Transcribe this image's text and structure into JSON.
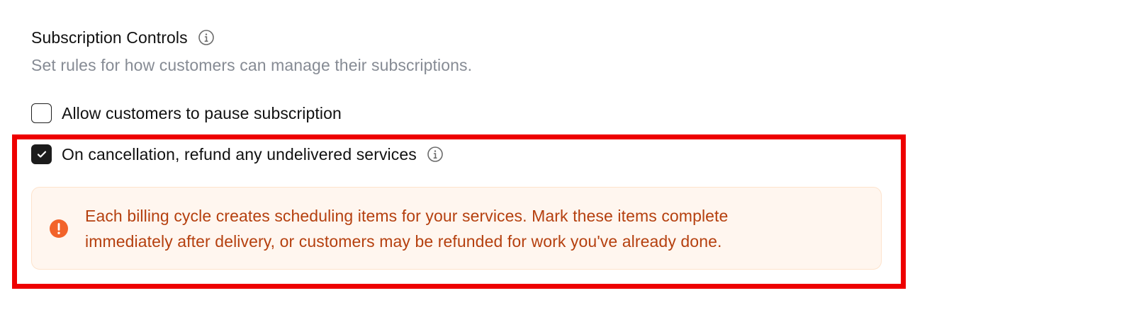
{
  "section": {
    "title": "Subscription Controls",
    "subtitle": "Set rules for how customers can manage their subscriptions."
  },
  "options": [
    {
      "label": "Allow customers to pause subscription",
      "checked": false
    },
    {
      "label": "On cancellation, refund any undelivered services",
      "checked": true
    }
  ],
  "warning": {
    "line1": "Each billing cycle creates scheduling items for your services. Mark these items complete",
    "line2": "immediately after delivery, or customers may be refunded for work you've already done."
  },
  "colors": {
    "warning_text": "#b5400f",
    "warning_bg": "#fff6ef",
    "warning_icon": "#f2632a",
    "highlight": "#ee0000",
    "checkbox_checked": "#1c1c1c"
  },
  "icons": {
    "title_info": "info-icon",
    "refund_info": "info-icon",
    "warning": "exclamation-circle-icon",
    "check": "check-icon"
  }
}
